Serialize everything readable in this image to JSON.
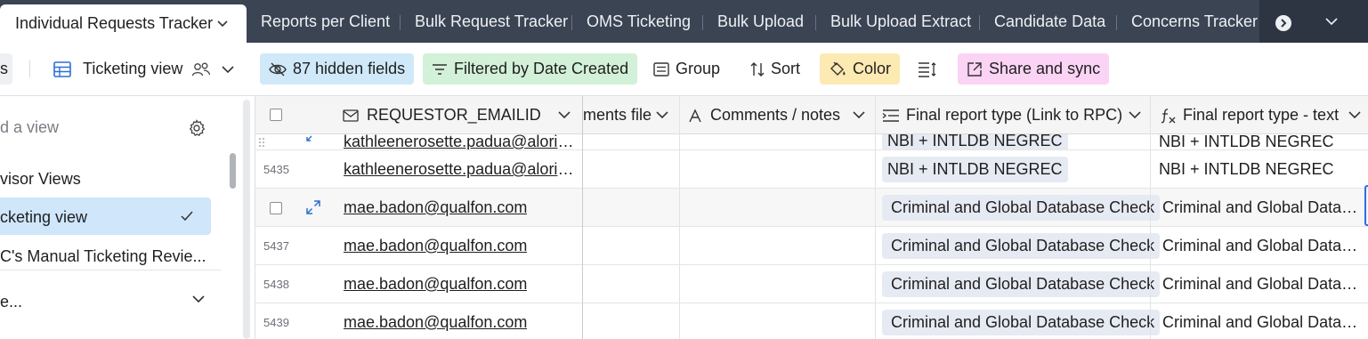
{
  "tabs": {
    "active": "Individual Requests Tracker",
    "items": [
      "Reports per Client",
      "Bulk Request Tracker",
      "OMS Ticketing",
      "Bulk Upload",
      "Bulk Upload Extract",
      "Candidate Data",
      "Concerns Tracker"
    ]
  },
  "toolbar": {
    "partial_label": "s",
    "view_name": "Ticketing view",
    "hidden_fields": "87 hidden fields",
    "filter": "Filtered by Date Created",
    "group": "Group",
    "sort": "Sort",
    "color": "Color",
    "share": "Share and sync"
  },
  "sidebar": {
    "find_placeholder": "d a view",
    "items": [
      "visor Views",
      "cketing view",
      "C's Manual Ticketing Revie...",
      "e..."
    ]
  },
  "grid": {
    "columns": [
      "REQUESTOR_EMAILID",
      "ments file",
      "Comments / notes",
      "Final report type (Link to RPC)",
      "Final report type - text"
    ],
    "partial_row": {
      "email": "kathleenerosette.padua@alorica.com",
      "chip": "NBI + INTLDB NEGREC",
      "text": "NBI + INTLDB NEGREC"
    },
    "rows": [
      {
        "num": "5435",
        "email": "kathleenerosette.padua@alorica.com",
        "chip": "NBI + INTLDB NEGREC",
        "text": "NBI + INTLDB NEGREC"
      },
      {
        "num": "",
        "email": "mae.badon@qualfon.com",
        "chip": "Criminal and Global Database Check",
        "text": "Criminal and Global Database Check"
      },
      {
        "num": "5437",
        "email": "mae.badon@qualfon.com",
        "chip": "Criminal and Global Database Check",
        "text": "Criminal and Global Database Check"
      },
      {
        "num": "5438",
        "email": "mae.badon@qualfon.com",
        "chip": "Criminal and Global Database Check",
        "text": "Criminal and Global Database Check"
      },
      {
        "num": "5439",
        "email": "mae.badon@qualfon.com",
        "chip": "Criminal and Global Database Check",
        "text": "Criminal and Global Database Check"
      }
    ]
  },
  "colors": {
    "tabbar": "#3b4453",
    "hidden_fields_bg": "#cfe9f9",
    "filter_bg": "#d3f1d8",
    "color_bg": "#fdeab2",
    "share_bg": "#fbd3f5",
    "selected_view_bg": "#cfe6fb",
    "chip_bg": "#e6eaf2"
  }
}
